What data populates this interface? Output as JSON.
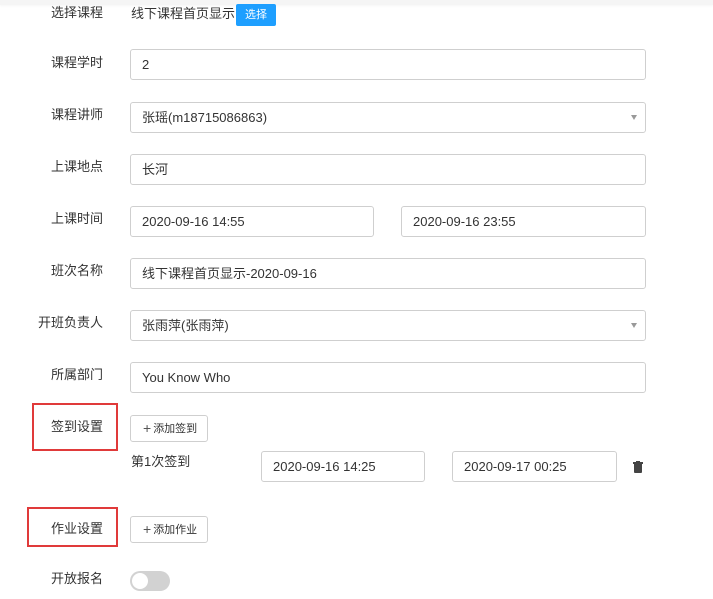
{
  "form": {
    "course": {
      "label": "选择课程",
      "value": "线下课程首页显示",
      "button": "选择"
    },
    "hours": {
      "label": "课程学时",
      "value": "2"
    },
    "lecturer": {
      "label": "课程讲师",
      "value": "张瑶(m18715086863)"
    },
    "location": {
      "label": "上课地点",
      "value": "长河"
    },
    "time": {
      "label": "上课时间",
      "start": "2020-09-16 14:55",
      "end": "2020-09-16 23:55"
    },
    "class_name": {
      "label": "班次名称",
      "value": "线下课程首页显示-2020-09-16"
    },
    "owner": {
      "label": "开班负责人",
      "value": "张雨萍(张雨萍)"
    },
    "department": {
      "label": "所属部门",
      "value": "You Know Who"
    },
    "sign_in": {
      "label": "签到设置",
      "add_button": "添加签到",
      "items": [
        {
          "label": "第1次签到",
          "start": "2020-09-16 14:25",
          "end": "2020-09-17 00:25"
        }
      ]
    },
    "homework": {
      "label": "作业设置",
      "add_button": "添加作业"
    },
    "open_registration": {
      "label": "开放报名",
      "enabled": false
    }
  },
  "icons": {
    "plus": "plus-icon",
    "trash": "trash-icon",
    "dropdown": "chevron-down-icon"
  },
  "colors": {
    "primary": "#1e9fff",
    "highlight": "#e03a3a",
    "toggle_off": "#d2d2d2"
  }
}
